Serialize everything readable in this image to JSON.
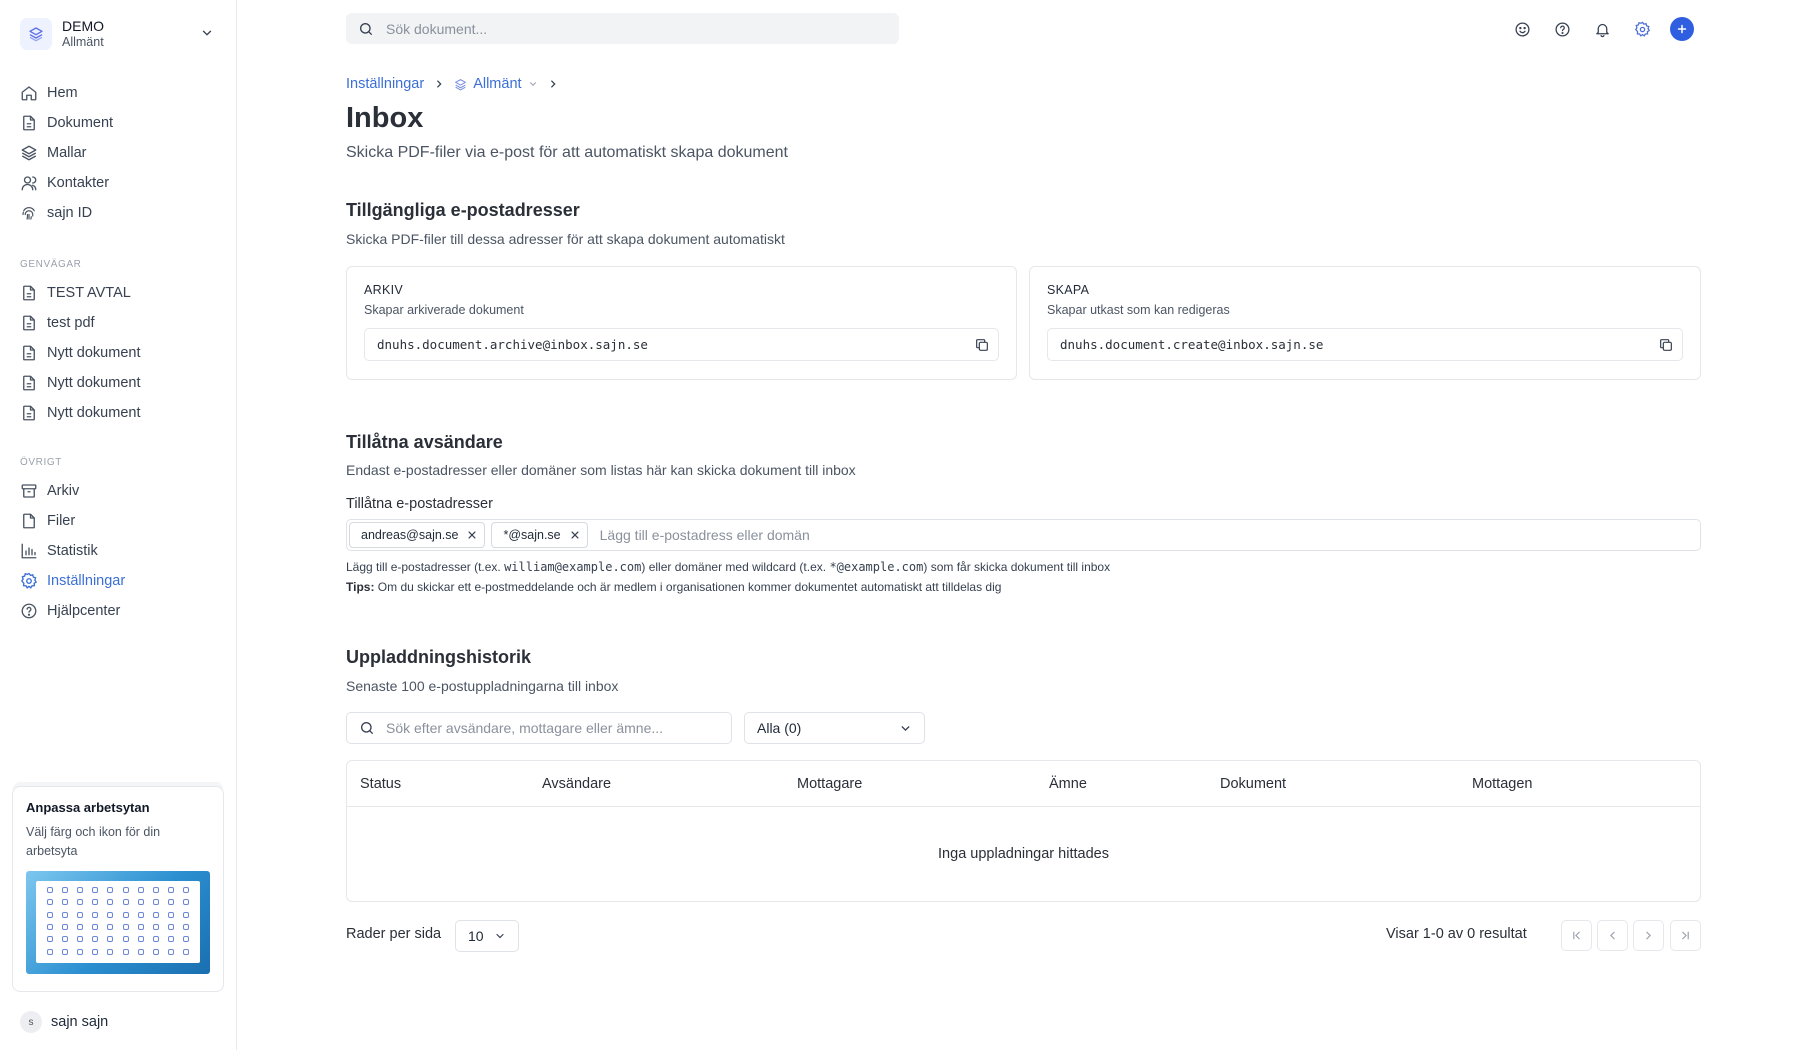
{
  "sidebar": {
    "workspace": {
      "name": "DEMO",
      "sub": "Allmänt"
    },
    "main_nav": [
      {
        "label": "Hem",
        "icon": "home-icon"
      },
      {
        "label": "Dokument",
        "icon": "document-icon"
      },
      {
        "label": "Mallar",
        "icon": "layers-icon"
      },
      {
        "label": "Kontakter",
        "icon": "contacts-icon"
      },
      {
        "label": "sajn ID",
        "icon": "fingerprint-icon"
      }
    ],
    "shortcuts_heading": "GENVÄGAR",
    "shortcuts": [
      {
        "label": "TEST AVTAL"
      },
      {
        "label": "test pdf"
      },
      {
        "label": "Nytt dokument"
      },
      {
        "label": "Nytt dokument"
      },
      {
        "label": "Nytt dokument"
      }
    ],
    "other_heading": "ÖVRIGT",
    "other": [
      {
        "label": "Arkiv",
        "icon": "archive-icon"
      },
      {
        "label": "Filer",
        "icon": "file-icon"
      },
      {
        "label": "Statistik",
        "icon": "chart-icon"
      },
      {
        "label": "Inställningar",
        "icon": "gear-icon",
        "active": true
      },
      {
        "label": "Hjälpcenter",
        "icon": "help-icon"
      }
    ],
    "promo": {
      "title": "Anpassa arbetsytan",
      "text": "Välj färg och ikon för din arbetsyta"
    },
    "user": {
      "initial": "s",
      "name": "sajn sajn"
    }
  },
  "topbar": {
    "search_placeholder": "Sök dokument..."
  },
  "breadcrumb": {
    "parent": "Inställningar",
    "workspace": "Allmänt"
  },
  "page": {
    "title": "Inbox",
    "subtitle": "Skicka PDF-filer via e-post för att automatiskt skapa dokument"
  },
  "addresses": {
    "heading": "Tillgängliga e-postadresser",
    "description": "Skicka PDF-filer till dessa adresser för att skapa dokument automatiskt",
    "archive": {
      "label": "ARKIV",
      "sub": "Skapar arkiverade dokument",
      "email": "dnuhs.document.archive@inbox.sajn.se"
    },
    "create": {
      "label": "SKAPA",
      "sub": "Skapar utkast som kan redigeras",
      "email": "dnuhs.document.create@inbox.sajn.se"
    }
  },
  "senders": {
    "heading": "Tillåtna avsändare",
    "description": "Endast e-postadresser eller domäner som listas här kan skicka dokument till inbox",
    "field_label": "Tillåtna e-postadresser",
    "tags": [
      "andreas@sajn.se",
      "*@sajn.se"
    ],
    "placeholder": "Lägg till e-postadress eller domän",
    "hint_a": "Lägg till e-postadresser (t.ex. ",
    "hint_code1": "william@example.com",
    "hint_b": ") eller domäner med wildcard (t.ex. ",
    "hint_code2": "*@example.com",
    "hint_c": ") som får skicka dokument till inbox",
    "tip_label": "Tips:",
    "tip_text": " Om du skickar ett e-postmeddelande och är medlem i organisationen kommer dokumentet automatiskt att tilldelas dig"
  },
  "history": {
    "heading": "Uppladdningshistorik",
    "description": "Senaste 100 e-postuppladningarna till inbox",
    "search_placeholder": "Sök efter avsändare, mottagare eller ämne...",
    "filter_value": "Alla (0)",
    "columns": [
      "Status",
      "Avsändare",
      "Mottagare",
      "Ämne",
      "Dokument",
      "Mottagen"
    ],
    "empty_text": "Inga uppladningar hittades",
    "rows_label": "Rader per sida",
    "rows_value": "10",
    "showing": "Visar 1-0 av 0 resultat"
  },
  "colors": {
    "accent": "#3b6fd6",
    "primary_button": "#2f5fe0",
    "border": "#e5e7eb"
  }
}
